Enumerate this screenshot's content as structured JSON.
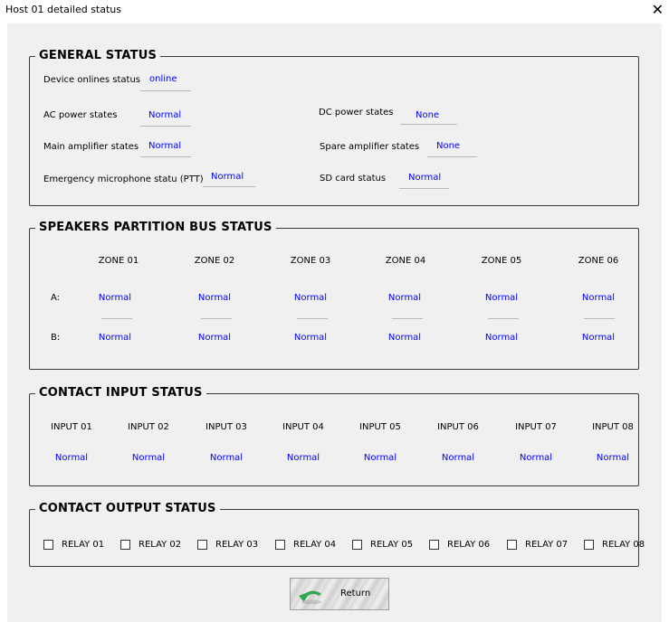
{
  "window": {
    "title": "Host 01 detailed status",
    "close_icon": "close-icon"
  },
  "general": {
    "title": "GENERAL STATUS",
    "device_online_label": "Device onlines status",
    "device_online_value": "online",
    "ac_power_label": "AC power states",
    "ac_power_value": "Normal",
    "dc_power_label": "DC power states",
    "dc_power_value": "None",
    "main_amp_label": "Main amplifier  states",
    "main_amp_value": "Normal",
    "spare_amp_label": "Spare amplifier  states",
    "spare_amp_value": "None",
    "emergency_mic_label": "Emergency microphone statu (PTT)",
    "emergency_mic_value": "Normal",
    "sd_card_label": "SD card status",
    "sd_card_value": "Normal"
  },
  "speakers": {
    "title": "SPEAKERS PARTITION BUS STATUS",
    "row_a_label": "A:",
    "row_b_label": "B:",
    "zones": [
      {
        "name": "ZONE 01",
        "a": "Normal",
        "b": "Normal"
      },
      {
        "name": "ZONE 02",
        "a": "Normal",
        "b": "Normal"
      },
      {
        "name": "ZONE 03",
        "a": "Normal",
        "b": "Normal"
      },
      {
        "name": "ZONE 04",
        "a": "Normal",
        "b": "Normal"
      },
      {
        "name": "ZONE 05",
        "a": "Normal",
        "b": "Normal"
      },
      {
        "name": "ZONE 06",
        "a": "Normal",
        "b": "Normal"
      }
    ]
  },
  "inputs": {
    "title": "CONTACT INPUT STATUS",
    "items": [
      {
        "name": "INPUT 01",
        "value": "Normal"
      },
      {
        "name": "INPUT 02",
        "value": "Normal"
      },
      {
        "name": "INPUT 03",
        "value": "Normal"
      },
      {
        "name": "INPUT 04",
        "value": "Normal"
      },
      {
        "name": "INPUT 05",
        "value": "Normal"
      },
      {
        "name": "INPUT 06",
        "value": "Normal"
      },
      {
        "name": "INPUT 07",
        "value": "Normal"
      },
      {
        "name": "INPUT 08",
        "value": "Normal"
      }
    ]
  },
  "outputs": {
    "title": "CONTACT OUTPUT STATUS",
    "relays": [
      {
        "label": "RELAY 01",
        "checked": false
      },
      {
        "label": "RELAY 02",
        "checked": false
      },
      {
        "label": "RELAY 03",
        "checked": false
      },
      {
        "label": "RELAY 04",
        "checked": false
      },
      {
        "label": "RELAY 05",
        "checked": false
      },
      {
        "label": "RELAY 06",
        "checked": false
      },
      {
        "label": "RELAY 07",
        "checked": false
      },
      {
        "label": "RELAY 08",
        "checked": false
      }
    ]
  },
  "footer": {
    "return_label": "Return",
    "return_icon": "return-arrow-icon"
  },
  "colors": {
    "value_text": "#0000ff",
    "dialog_bg": "#f0f0f0",
    "return_icon": "#2fa84f"
  }
}
